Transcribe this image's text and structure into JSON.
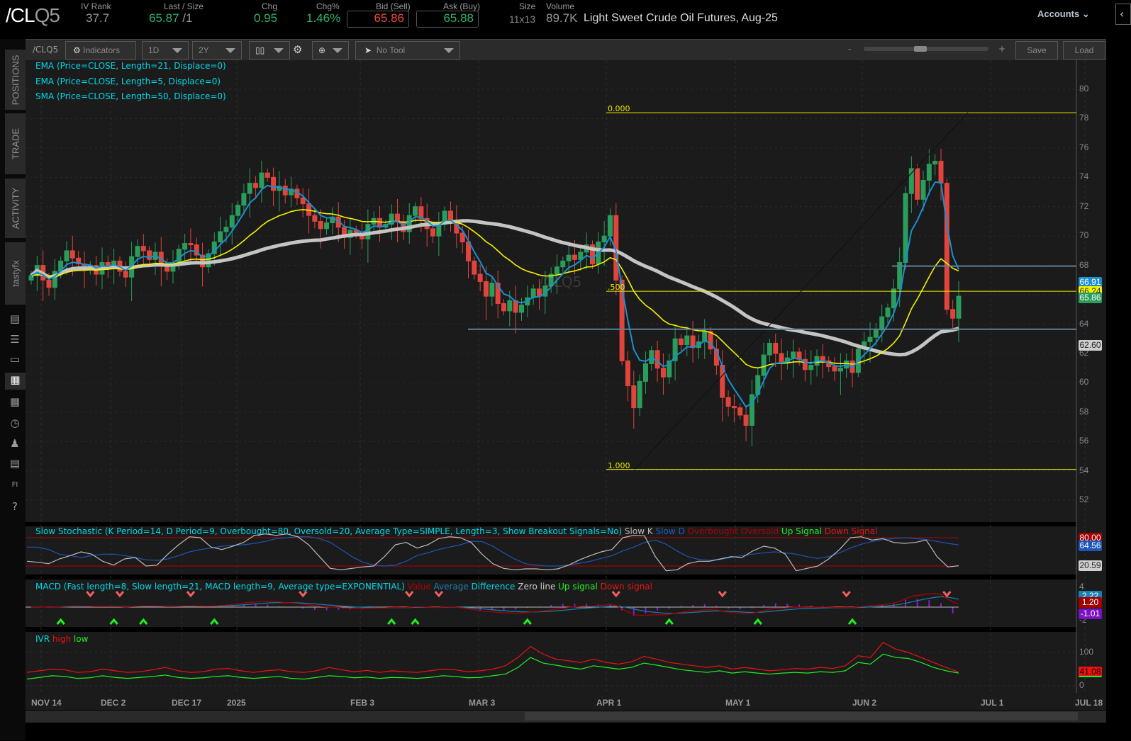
{
  "header": {
    "symbol_main": "/CL",
    "symbol_suffix": "Q5",
    "fields": [
      {
        "label": "IV Rank",
        "value": "37.7"
      },
      {
        "label": "Last / Size",
        "value": "65.87",
        "size": "/1"
      },
      {
        "label": "Chg",
        "value": "0.95"
      },
      {
        "label": "Chg%",
        "value": "1.46%"
      },
      {
        "label": "Bid (Sell)",
        "value": "65.86"
      },
      {
        "label": "Ask (Buy)",
        "value": "65.88"
      },
      {
        "label": "Size",
        "value": "11x13"
      },
      {
        "label": "Volume",
        "value": "89.7K"
      }
    ],
    "description": "Light Sweet Crude Oil Futures, Aug-25",
    "accounts": "Accounts"
  },
  "colors": {
    "up": "#2a9d5c",
    "down": "#e0443c",
    "ema5": "#1a8fd0",
    "ema21": "#f2f200",
    "sma50": "#c4c4c4",
    "bg": "#1b1b1b"
  },
  "toolbar": {
    "symbol": "/CLQ5",
    "indicators": "Indicators",
    "aggregation": "1D",
    "range": "2Y",
    "tool": "No Tool",
    "zoom_minus": "-",
    "zoom_plus": "+",
    "save": "Save",
    "load": "Load",
    "zoom_level": 0.45
  },
  "sidebar": {
    "tabs": [
      "POSITIONS",
      "TRADE",
      "ACTIVITY",
      "tastyfx"
    ]
  },
  "studies": {
    "ema21": "EMA (Price=CLOSE, Length=21, Displace=0)",
    "ema5": "EMA (Price=CLOSE, Length=5, Displace=0)",
    "sma50": "SMA (Price=CLOSE, Length=50, Displace=0)",
    "stoch": {
      "title": "Slow Stochastic (K Period=14, D Period=9, Overbought=80, Oversold=20, Average Type=SIMPLE, Length=3, Show Breakout Signals=No)",
      "items": [
        {
          "t": "Slow K",
          "c": "#bbbbbb"
        },
        {
          "t": "Slow D",
          "c": "#1d5fc4"
        },
        {
          "t": "Overbought",
          "c": "#b00000"
        },
        {
          "t": "Oversold",
          "c": "#b00000"
        },
        {
          "t": "Up Signal",
          "c": "#22ee22"
        },
        {
          "t": "Down Signal",
          "c": "#ee1111"
        }
      ]
    },
    "macd": {
      "title": "MACD (Fast length=8, Slow length=21, MACD length=9, Average type=EXPONENTIAL)",
      "items": [
        {
          "t": "Value",
          "c": "#b00000"
        },
        {
          "t": "Average",
          "c": "#1a7fb0"
        },
        {
          "t": "Difference",
          "c": "#00d8e8"
        },
        {
          "t": "Zero line",
          "c": "#cccccc"
        },
        {
          "t": "Up signal",
          "c": "#22ee22"
        },
        {
          "t": "Down signal",
          "c": "#ee1111"
        }
      ]
    },
    "ivr": {
      "title": "IVR",
      "items": [
        {
          "t": "high",
          "c": "#ee1111"
        },
        {
          "t": "low",
          "c": "#22ee22"
        }
      ]
    }
  },
  "chart_data": {
    "type": "candlestick",
    "ylim": [
      51,
      81
    ],
    "yticks": [
      "80",
      "78",
      "76",
      "74",
      "72",
      "70",
      "68",
      "66",
      "64",
      "62",
      "60",
      "58",
      "56",
      "54",
      "52"
    ],
    "xticks": [
      "NOV 14",
      "DEC 2",
      "DEC 17",
      "2025",
      "FEB 3",
      "MAR 3",
      "APR 1",
      "MAY 1",
      "JUN 2",
      "JUL 1",
      "JUL 18"
    ],
    "closes": [
      67.3,
      68.0,
      67.0,
      66.5,
      67.6,
      68.3,
      69.0,
      68.5,
      68.1,
      67.8,
      68.0,
      67.4,
      68.2,
      67.9,
      68.3,
      67.6,
      67.2,
      68.6,
      69.3,
      69.0,
      68.4,
      68.9,
      68.0,
      67.6,
      68.2,
      69.1,
      69.5,
      69.4,
      68.7,
      67.9,
      68.8,
      69.6,
      70.3,
      70.6,
      71.4,
      72.1,
      72.9,
      73.6,
      73.3,
      74.3,
      74.0,
      73.1,
      73.4,
      72.8,
      73.2,
      72.6,
      72.2,
      71.4,
      71.0,
      70.5,
      70.9,
      71.3,
      70.6,
      69.9,
      70.4,
      70.2,
      69.8,
      70.8,
      71.2,
      70.6,
      70.8,
      71.5,
      71.0,
      70.3,
      71.4,
      72.0,
      71.2,
      70.5,
      70.0,
      70.8,
      71.7,
      71.1,
      70.2,
      69.6,
      68.3,
      67.4,
      66.9,
      65.9,
      66.8,
      65.4,
      64.9,
      65.6,
      64.8,
      65.3,
      65.8,
      66.4,
      65.9,
      66.6,
      67.4,
      67.9,
      68.3,
      68.7,
      68.4,
      68.9,
      69.4,
      68.1,
      69.6,
      70.0,
      71.4,
      67.0,
      61.5,
      59.8,
      58.3,
      60.1,
      61.3,
      62.2,
      61.0,
      60.4,
      61.5,
      63.0,
      62.6,
      63.2,
      62.4,
      62.8,
      63.5,
      62.3,
      61.2,
      59.0,
      58.4,
      58.3,
      57.8,
      57.1,
      59.2,
      60.5,
      61.9,
      62.7,
      62.0,
      61.4,
      61.7,
      62.1,
      61.6,
      60.9,
      61.2,
      61.8,
      61.5,
      61.1,
      60.8,
      61.0,
      61.5,
      60.7,
      62.3,
      62.8,
      63.1,
      63.6,
      64.5,
      65.1,
      66.4,
      68.2,
      72.9,
      74.6,
      72.5,
      73.8,
      74.9,
      75.1,
      73.6,
      65.0,
      64.4,
      65.9
    ],
    "fib": [
      {
        "label": "0.000",
        "price": 78.4
      },
      {
        "label": ".500",
        "price": 66.24
      },
      {
        "label": "1.000",
        "price": 54.1
      }
    ],
    "levels": [
      67.95,
      63.65
    ],
    "last_badges": [
      {
        "value": "66.91",
        "bg": "#1a8fd0",
        "fg": "#fff"
      },
      {
        "value": "66.24",
        "bg": "#f2f200",
        "fg": "#333"
      },
      {
        "value": "65.86",
        "bg": "#2a9d5c",
        "fg": "#fff"
      },
      {
        "value": "62.60",
        "bg": "#cfcfcf",
        "fg": "#222"
      }
    ],
    "stoch_k": [
      30,
      28,
      25,
      35,
      42,
      50,
      45,
      30,
      22,
      35,
      38,
      20,
      22,
      45,
      65,
      82,
      80,
      60,
      55,
      62,
      70,
      85,
      88,
      85,
      88,
      82,
      65,
      40,
      15,
      12,
      15,
      18,
      20,
      40,
      65,
      70,
      58,
      65,
      78,
      82,
      80,
      70,
      45,
      25,
      15,
      12,
      14,
      14,
      12,
      14,
      22,
      33,
      42,
      50,
      55,
      80,
      85,
      84,
      40,
      10,
      12,
      25,
      30,
      30,
      35,
      40,
      38,
      52,
      62,
      58,
      45,
      10,
      15,
      20,
      35,
      55,
      80,
      82,
      75,
      78,
      70,
      68,
      70,
      75,
      40,
      18,
      20.6
    ],
    "stoch_d": [
      60,
      60,
      55,
      45,
      42,
      38,
      42,
      45,
      45,
      42,
      38,
      33,
      32,
      35,
      42,
      50,
      55,
      58,
      62,
      64,
      65,
      68,
      72,
      78,
      80,
      82,
      82,
      78,
      70,
      55,
      40,
      28,
      22,
      20,
      22,
      30,
      42,
      48,
      55,
      60,
      65,
      72,
      72,
      62,
      48,
      35,
      25,
      22,
      20,
      20,
      22,
      26,
      30,
      36,
      42,
      52,
      60,
      70,
      75,
      66,
      52,
      40,
      34,
      32,
      34,
      38,
      42,
      45,
      48,
      50,
      48,
      45,
      40,
      36,
      40,
      48,
      58,
      66,
      72,
      76,
      78,
      80,
      78,
      76,
      72,
      68,
      64.6
    ],
    "stoch_badges": [
      {
        "value": "80.00",
        "bg": "#a00000"
      },
      {
        "value": "64.56",
        "bg": "#1d55b8"
      },
      {
        "value": "20.59",
        "bg": "#cfcfcf",
        "fg": "#222"
      }
    ],
    "macd_badges": [
      {
        "value": "2.22",
        "bg": "#1a7fb0"
      },
      {
        "value": "1.20",
        "bg": "#a00000"
      },
      {
        "value": "-1.01",
        "bg": "#7a10c0"
      }
    ],
    "macd_yticks": [
      "4",
      "-2"
    ],
    "macd_down_idx": [
      10,
      15,
      27,
      46,
      64,
      69,
      99,
      117,
      138,
      155
    ],
    "macd_up_idx": [
      5,
      14,
      19,
      31,
      61,
      65,
      84,
      108,
      123,
      139
    ],
    "ivr_high": [
      40,
      45,
      50,
      48,
      40,
      42,
      50,
      45,
      40,
      42,
      48,
      55,
      45,
      40,
      42,
      50,
      52,
      45,
      40,
      45,
      48,
      42,
      40,
      45,
      55,
      48,
      42,
      46,
      40,
      45,
      42,
      40,
      45,
      50,
      48,
      42,
      45,
      50,
      60,
      85,
      118,
      95,
      80,
      75,
      70,
      80,
      70,
      65,
      72,
      88,
      80,
      70,
      65,
      60,
      55,
      60,
      50,
      55,
      50,
      45,
      48,
      52,
      50,
      55,
      52,
      60,
      90,
      85,
      130,
      110,
      100,
      85,
      70,
      55,
      41.08
    ],
    "ivr_low": [
      20,
      25,
      30,
      28,
      22,
      24,
      30,
      25,
      22,
      25,
      28,
      32,
      25,
      22,
      24,
      28,
      30,
      25,
      22,
      25,
      28,
      22,
      20,
      25,
      30,
      28,
      24,
      26,
      22,
      25,
      24,
      22,
      25,
      30,
      28,
      24,
      25,
      30,
      35,
      55,
      85,
      68,
      62,
      55,
      50,
      60,
      55,
      50,
      55,
      68,
      62,
      55,
      48,
      44,
      40,
      45,
      38,
      42,
      38,
      35,
      38,
      40,
      38,
      42,
      40,
      45,
      70,
      65,
      95,
      85,
      82,
      70,
      55,
      45,
      38
    ],
    "ivr_yticks": [
      "100",
      "0"
    ],
    "ivr_badge": {
      "value": "41.08",
      "bg": "#ee1111"
    }
  }
}
